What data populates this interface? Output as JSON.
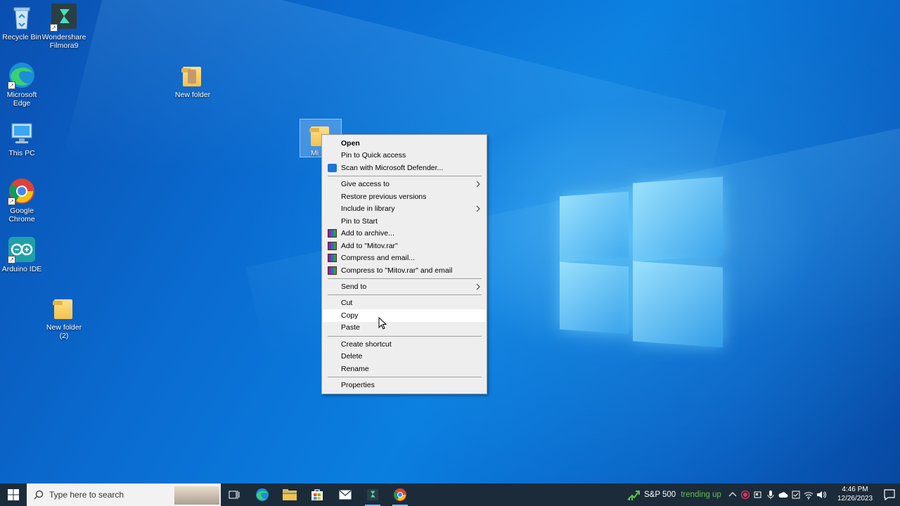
{
  "desktop": {
    "icons": [
      {
        "label": "Recycle Bin"
      },
      {
        "label": "Wondershare Filmora9"
      },
      {
        "label": "Microsoft Edge"
      },
      {
        "label": "New folder"
      },
      {
        "label": "This PC"
      },
      {
        "label": "Google Chrome"
      },
      {
        "label": "Arduino IDE"
      },
      {
        "label": "New folder (2)"
      },
      {
        "label": "Mi"
      }
    ]
  },
  "context_menu": {
    "items": [
      {
        "label": "Open",
        "icon": "",
        "submenu": false
      },
      {
        "label": "Pin to Quick access",
        "icon": "",
        "submenu": false
      },
      {
        "label": "Scan with Microsoft Defender...",
        "icon": "defender-icon",
        "submenu": false
      },
      {
        "label": "Give access to",
        "icon": "",
        "submenu": true
      },
      {
        "label": "Restore previous versions",
        "icon": "",
        "submenu": false
      },
      {
        "label": "Include in library",
        "icon": "",
        "submenu": true
      },
      {
        "label": "Pin to Start",
        "icon": "",
        "submenu": false
      },
      {
        "label": "Add to archive...",
        "icon": "winrar-icon",
        "submenu": false
      },
      {
        "label": "Add to \"Mitov.rar\"",
        "icon": "winrar-icon",
        "submenu": false
      },
      {
        "label": "Compress and email...",
        "icon": "winrar-icon",
        "submenu": false
      },
      {
        "label": "Compress to \"Mitov.rar\" and email",
        "icon": "winrar-icon",
        "submenu": false
      },
      {
        "label": "Send to",
        "icon": "",
        "submenu": true
      },
      {
        "label": "Cut",
        "icon": "",
        "submenu": false
      },
      {
        "label": "Copy",
        "icon": "",
        "submenu": false,
        "hovered": true
      },
      {
        "label": "Paste",
        "icon": "",
        "submenu": false
      },
      {
        "label": "Create shortcut",
        "icon": "",
        "submenu": false
      },
      {
        "label": "Delete",
        "icon": "",
        "submenu": false
      },
      {
        "label": "Rename",
        "icon": "",
        "submenu": false
      },
      {
        "label": "Properties",
        "icon": "",
        "submenu": false
      }
    ]
  },
  "taskbar": {
    "search_placeholder": "Type here to search",
    "pinned": [
      "task-view-icon",
      "edge-icon",
      "file-explorer-icon",
      "store-icon",
      "mail-icon",
      "filmora-icon",
      "chrome-icon"
    ],
    "widget": {
      "name": "S&P 500",
      "trend": "trending up"
    },
    "clock": {
      "time": "4:46 PM",
      "date": "12/26/2023"
    }
  },
  "colors": {
    "accent": "#0a6bd0",
    "taskbar_bg": "#1b2b3a",
    "menu_bg": "#eeeeee",
    "trend_green": "#5fc24a"
  }
}
